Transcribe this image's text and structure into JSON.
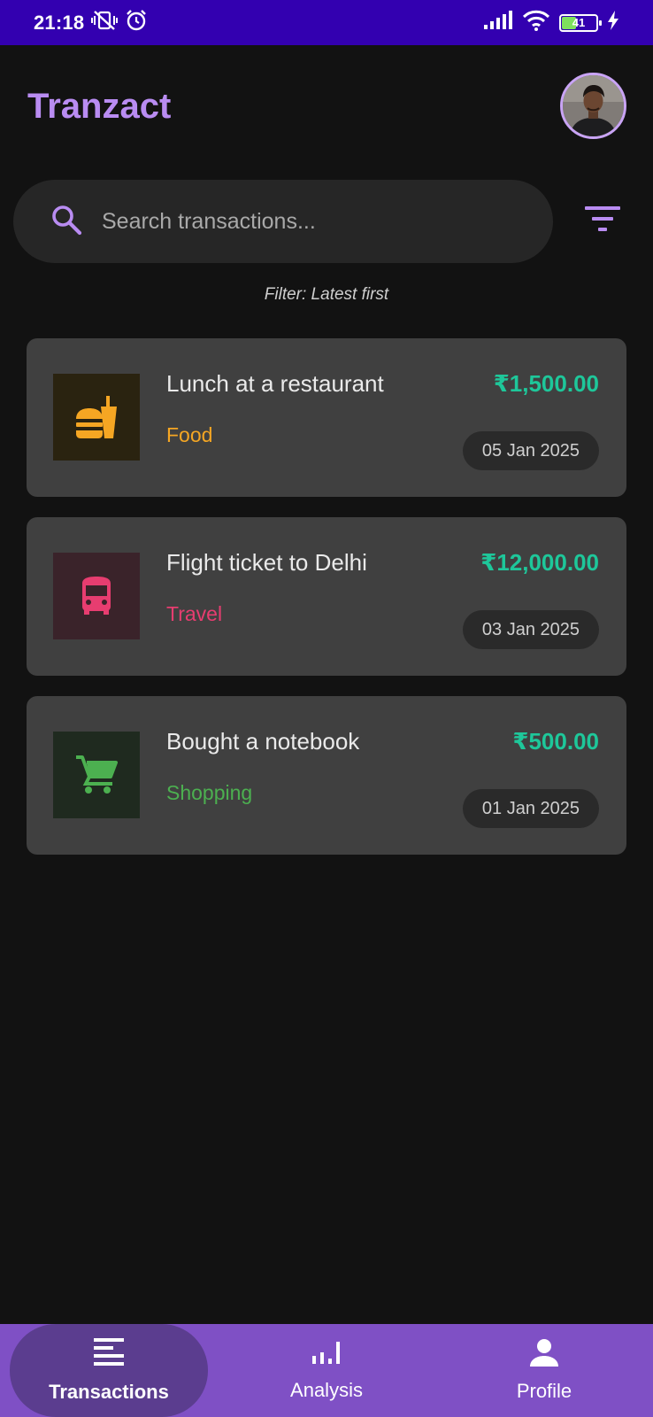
{
  "status_bar": {
    "time": "21:18",
    "battery": "41",
    "icons": [
      "vibrate-off-icon",
      "alarm-icon",
      "signal-icon",
      "wifi-icon",
      "battery-icon",
      "charging-icon"
    ]
  },
  "header": {
    "title": "Tranzact",
    "title_color": "#b98cf2"
  },
  "search": {
    "placeholder": "Search transactions...",
    "value": ""
  },
  "filter": {
    "label": "Filter: Latest first"
  },
  "transactions": [
    {
      "title": "Lunch at a restaurant",
      "category": "Food",
      "category_color": "#f5a623",
      "icon": "fastfood-icon",
      "amount": "₹1,500.00",
      "date": "05 Jan 2025"
    },
    {
      "title": "Flight ticket to Delhi",
      "category": "Travel",
      "category_color": "#e73d70",
      "icon": "bus-icon",
      "amount": "₹12,000.00",
      "date": "03 Jan 2025"
    },
    {
      "title": "Bought a notebook",
      "category": "Shopping",
      "category_color": "#4cb050",
      "icon": "cart-icon",
      "amount": "₹500.00",
      "date": "01 Jan 2025"
    }
  ],
  "amount_color": "#1ec79a",
  "bottom_nav": {
    "items": [
      {
        "label": "Transactions",
        "icon": "list-icon",
        "active": true
      },
      {
        "label": "Analysis",
        "icon": "bar-chart-icon",
        "active": false
      },
      {
        "label": "Profile",
        "icon": "person-icon",
        "active": false
      }
    ],
    "background": "#7f50c5"
  }
}
